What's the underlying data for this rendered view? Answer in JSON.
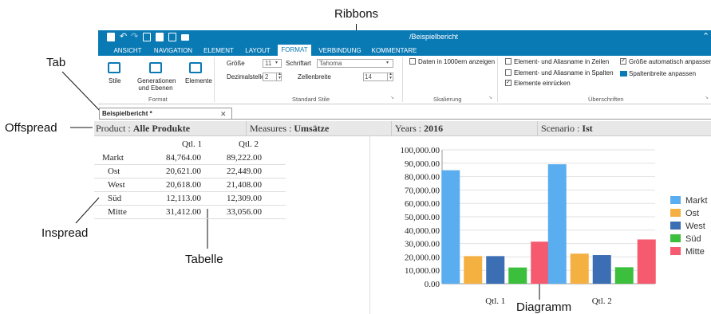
{
  "annotations": {
    "ribbons": "Ribbons",
    "tab": "Tab",
    "offspread": "Offspread",
    "inspread": "Inspread",
    "tabelle": "Tabelle",
    "diagramm": "Diagramm"
  },
  "window": {
    "title": "/Beispielbericht",
    "accent": "#0a7ab5"
  },
  "ribbon_tabs": [
    "ANSICHT",
    "NAVIGATION",
    "ELEMENT",
    "LAYOUT",
    "FORMAT",
    "VERBINDUNG",
    "KOMMENTARE"
  ],
  "active_tab": "FORMAT",
  "format_group": {
    "buttons": [
      "Stile",
      "Generationen und Ebenen",
      "Elemente"
    ],
    "label": "Format"
  },
  "standard_stile": {
    "label": "Standard Stile",
    "groesse_label": "Größe",
    "groesse_value": "11",
    "dezimal_label": "Dezimalstellen",
    "dezimal_value": "2",
    "schriftart_label": "Schriftart",
    "schriftart_value": "Tahoma",
    "zellenbreite_label": "Zellenbreite",
    "zellenbreite_value": "14"
  },
  "skalierung": {
    "label": "Skalierung",
    "check_label": "Daten in 1000ern anzeigen"
  },
  "ueberschriften": {
    "label": "Überschriften",
    "zeilen": "Element- und Aliasname in Zeilen",
    "spalten": "Element- und Aliasname in Spalten",
    "einruecken": "Elemente einrücken",
    "groesse": "Größe automatisch anpassen",
    "spaltenbreite": "Spaltenbreite anpassen"
  },
  "doc_tab": {
    "label": "Beispielbericht *",
    "close": "✕"
  },
  "pov": [
    {
      "dim": "Product",
      "member": "Alle Produkte"
    },
    {
      "dim": "Measures",
      "member": "Umsätze"
    },
    {
      "dim": "Years",
      "member": "2016"
    },
    {
      "dim": "Scenario",
      "member": "Ist"
    }
  ],
  "grid": {
    "columns": [
      "Qtl. 1",
      "Qtl. 2"
    ],
    "rows": [
      {
        "label": "Markt",
        "values": [
          "84,764.00",
          "89,222.00"
        ]
      },
      {
        "label": "Ost",
        "values": [
          "20,621.00",
          "22,449.00"
        ]
      },
      {
        "label": "West",
        "values": [
          "20,618.00",
          "21,408.00"
        ]
      },
      {
        "label": "Süd",
        "values": [
          "12,113.00",
          "12,309.00"
        ]
      },
      {
        "label": "Mitte",
        "values": [
          "31,412.00",
          "33,056.00"
        ]
      }
    ]
  },
  "chart_data": {
    "type": "bar",
    "categories": [
      "Qtl. 1",
      "Qtl. 2"
    ],
    "series": [
      {
        "name": "Markt",
        "values": [
          84764,
          89222
        ],
        "color": "#5aaef0"
      },
      {
        "name": "Ost",
        "values": [
          20621,
          22449
        ],
        "color": "#f5b042"
      },
      {
        "name": "West",
        "values": [
          20618,
          21408
        ],
        "color": "#3c6eb4"
      },
      {
        "name": "Süd",
        "values": [
          12113,
          12309
        ],
        "color": "#3cbf3c"
      },
      {
        "name": "Mitte",
        "values": [
          31412,
          33056
        ],
        "color": "#f55a6e"
      }
    ],
    "yticks": [
      "100,000.00",
      "90,000.00",
      "80,000.00",
      "70,000.00",
      "60,000.00",
      "50,000.00",
      "40,000.00",
      "30,000.00",
      "20,000.00",
      "10,000.00",
      "0.00"
    ],
    "ylim": [
      0,
      100000
    ],
    "grid": true,
    "legend_position": "right"
  }
}
